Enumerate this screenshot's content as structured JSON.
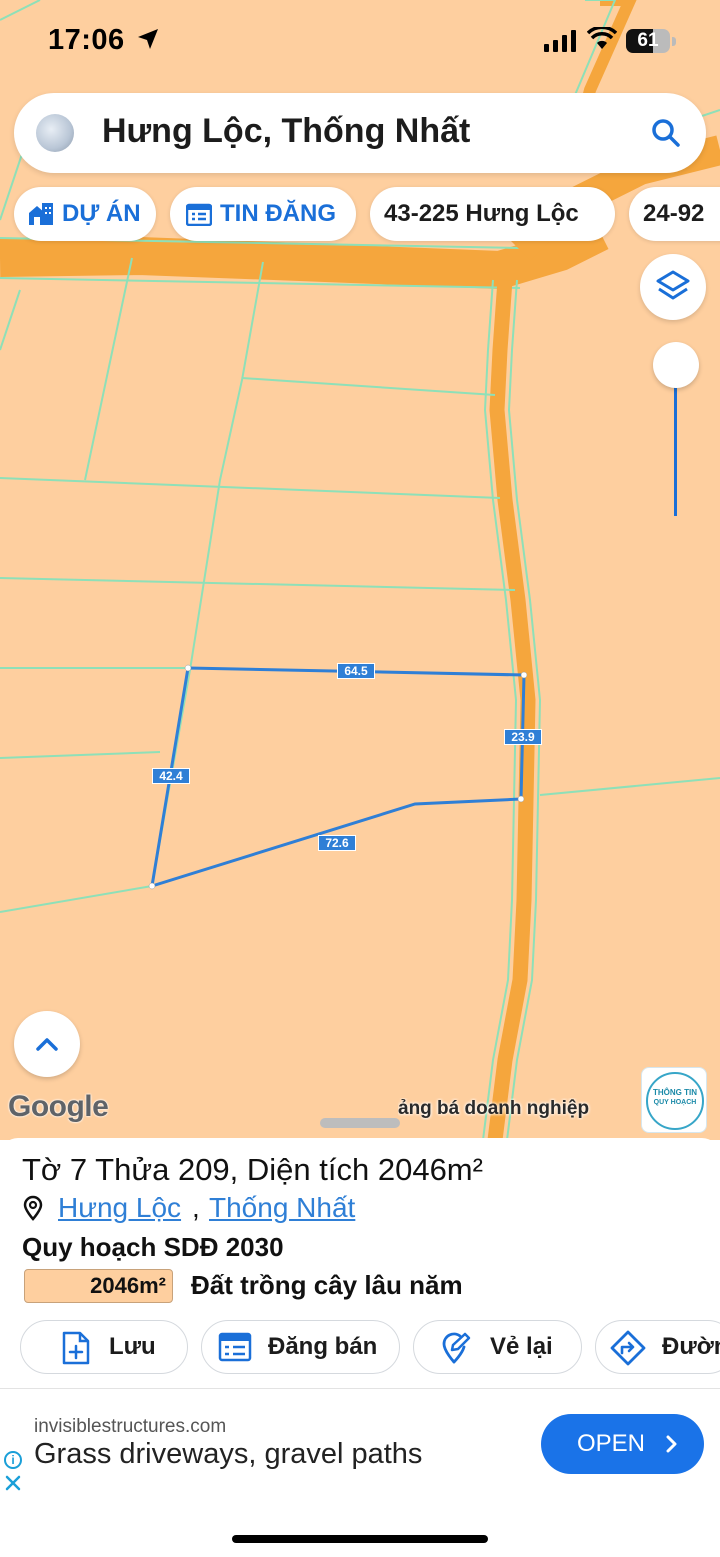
{
  "status_bar": {
    "time": "17:06",
    "battery": "61"
  },
  "search": {
    "query": "Hưng Lộc, Thống Nhất"
  },
  "chips": [
    {
      "label": "DỰ ÁN",
      "icon": "house-building-icon"
    },
    {
      "label": "TIN ĐĂNG",
      "icon": "calendar-list-icon"
    },
    {
      "label": "43-225 Hưng Lộc"
    },
    {
      "label": "24-92"
    }
  ],
  "map": {
    "parcel_edges": {
      "top": "64.5",
      "right": "23.9",
      "bottom": "72.6",
      "left": "42.4"
    },
    "google_logo": "Google",
    "promo_text": "ảng bá doanh nghiệp",
    "badge_line1": "THÔNG TIN",
    "badge_line2": "QUY HOẠCH",
    "colors": {
      "land": "#fecf9f",
      "road": "#f5a63d",
      "parcel_line": "#8ee0b8",
      "selection": "#2f7fd6"
    }
  },
  "sheet": {
    "title": "Tờ 7 Thửa 209, Diện tích 2046m²",
    "location_parts": [
      "Hưng Lộc",
      "Thống Nhất"
    ],
    "location_separator": ",",
    "plan_title": "Quy hoạch SDĐ 2030",
    "legend": {
      "area": "2046m²",
      "label": "Đất trồng cây lâu năm",
      "color": "#fecf9f"
    },
    "actions": [
      {
        "label": "Lưu",
        "icon": "document-add-icon"
      },
      {
        "label": "Đăng bán",
        "icon": "calendar-list-icon"
      },
      {
        "label": "Vẻ lại",
        "icon": "map-pin-edit-icon"
      },
      {
        "label": "Đườn",
        "icon": "directions-icon"
      }
    ]
  },
  "ad": {
    "domain": "invisiblestructures.com",
    "headline": "Grass driveways, gravel paths",
    "cta": "OPEN"
  }
}
